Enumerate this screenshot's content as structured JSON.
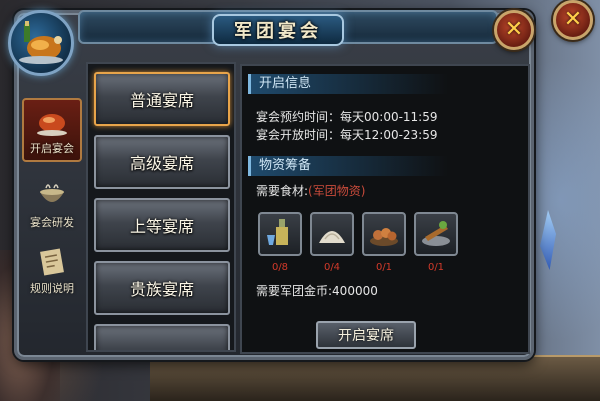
{
  "window": {
    "title": "军团宴会"
  },
  "side_tabs": [
    {
      "label": "开启宴会",
      "icon": "roast-dish-icon",
      "active": true
    },
    {
      "label": "宴会研发",
      "icon": "cauldron-icon",
      "active": false
    },
    {
      "label": "规则说明",
      "icon": "scroll-icon",
      "active": false
    }
  ],
  "banquet_types": [
    {
      "label": "普通宴席",
      "selected": true
    },
    {
      "label": "高级宴席",
      "selected": false
    },
    {
      "label": "上等宴席",
      "selected": false
    },
    {
      "label": "贵族宴席",
      "selected": false
    }
  ],
  "info": {
    "heading": "开启信息",
    "reserve_time": "宴会预约时间：每天00:00-11:59",
    "open_time": "宴会开放时间：每天12:00-23:59"
  },
  "materials": {
    "heading": "物资筹备",
    "ingredients_label": "需要食材:",
    "ingredients_source": "(军团物资)",
    "items": [
      {
        "icon": "wine-bottle-icon",
        "count": "0/8"
      },
      {
        "icon": "flour-sack-icon",
        "count": "0/4"
      },
      {
        "icon": "eggs-basket-icon",
        "count": "0/1"
      },
      {
        "icon": "grilled-meat-icon",
        "count": "0/1"
      }
    ],
    "gold_label": "需要军团金币:",
    "gold_value": "400000"
  },
  "actions": {
    "open_banquet": "开启宴席"
  },
  "colors": {
    "accent_red": "#c94b3b",
    "selected_border": "#e8a44a",
    "heading_blue": "#cfe6f5"
  }
}
